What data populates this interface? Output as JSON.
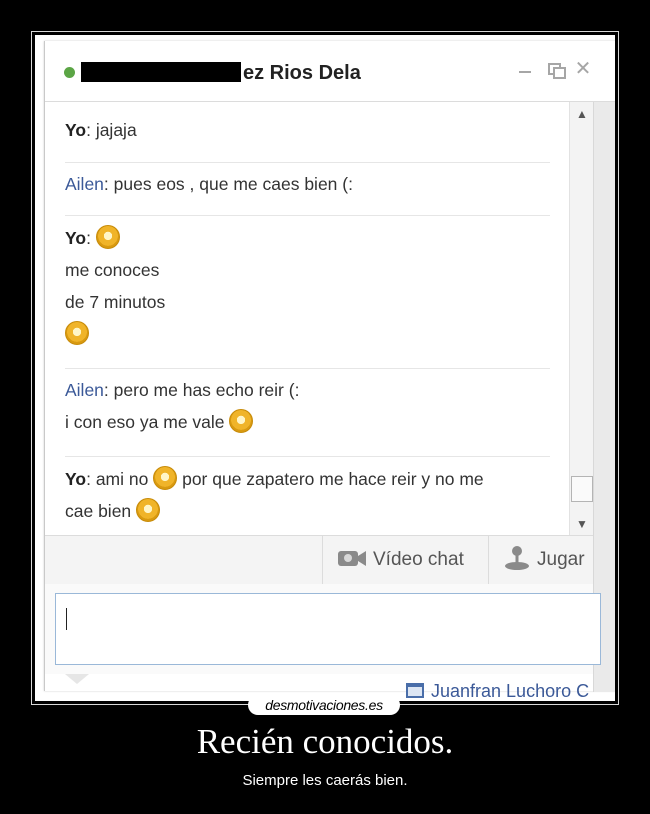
{
  "chat_window": {
    "title_suffix": "ez Rios Dela",
    "status_color": "#5ba545",
    "controls": {
      "minimize_icon": "minimize-icon",
      "popout_icon": "popout-icon",
      "close_icon": "close-icon"
    }
  },
  "messages": [
    {
      "sender": "Yo",
      "lines": [
        {
          "text": "jajaja",
          "smiley_after": false
        }
      ]
    },
    {
      "sender": "Ailen",
      "lines": [
        {
          "text": "pues eos , que me caes bien (:",
          "smiley_after": false
        }
      ]
    },
    {
      "sender": "Yo",
      "lines": [
        {
          "text": "",
          "smiley_after": true
        },
        {
          "text": "me conoces",
          "smiley_after": false
        },
        {
          "text": "de 7 minutos",
          "smiley_after": false
        },
        {
          "text": "",
          "smiley_after": true
        }
      ]
    },
    {
      "sender": "Ailen",
      "lines": [
        {
          "text": "pero me has echo reir (:",
          "smiley_after": false
        },
        {
          "text": "i con eso ya me vale",
          "smiley_after": true
        }
      ]
    },
    {
      "sender": "Yo",
      "lines": [
        {
          "text": "ami no",
          "smiley_after": true,
          "text_after": "por que zapatero me hace reir y no me"
        },
        {
          "text": "cae bien",
          "smiley_after": true
        }
      ]
    }
  ],
  "actions": {
    "video_chat": "Vídeo chat",
    "play": "Jugar"
  },
  "input": {
    "value": ""
  },
  "background_contact": "Juanfran Luchoro C",
  "poster": {
    "watermark": "desmotivaciones.es",
    "caption": "Recién conocidos.",
    "subcaption": "Siempre les caerás bien."
  }
}
